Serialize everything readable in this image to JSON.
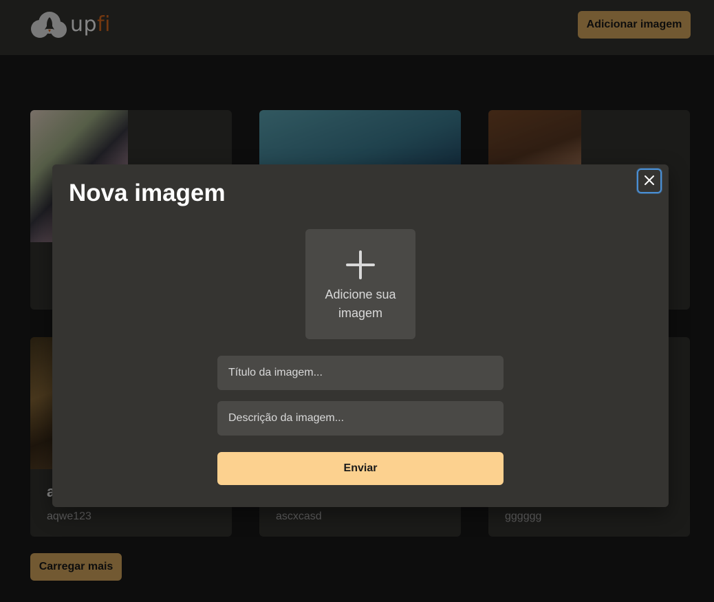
{
  "header": {
    "logo_text": "up",
    "logo_accent": "fi",
    "add_image_label": "Adicionar imagem"
  },
  "cards": [
    {
      "title": "",
      "description": ""
    },
    {
      "title": "",
      "description": ""
    },
    {
      "title": "",
      "description": ""
    },
    {
      "title": "a",
      "description": "aqwe123"
    },
    {
      "title": "",
      "description": "ascxcasd"
    },
    {
      "title": "",
      "description": "gggggg"
    }
  ],
  "load_more_label": "Carregar mais",
  "modal": {
    "title": "Nova imagem",
    "upload_label": "Adicione sua imagem",
    "title_placeholder": "Título da imagem...",
    "description_placeholder": "Descrição da imagem...",
    "submit_label": "Enviar"
  },
  "colors": {
    "background": "#1a1a1a",
    "surface": "#353431",
    "accent": "#dbab60",
    "submit": "#fcd18f",
    "logo_accent": "#dd6b20",
    "focus_ring": "#4a8fd4"
  },
  "icons": {
    "logo": "cloud-rocket-icon",
    "upload": "plus-icon",
    "close": "close-icon"
  }
}
